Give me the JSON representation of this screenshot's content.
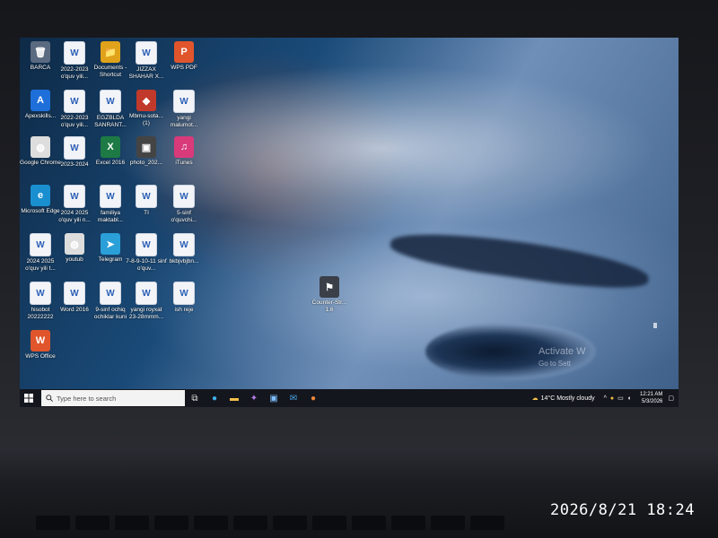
{
  "desktop": {
    "icons": [
      {
        "label": "BARCA",
        "glyph": "🗑",
        "color": "#5a6a80"
      },
      {
        "label": "2022-2023 o'quv yili...",
        "glyph": "W",
        "color": "#2b5fb7"
      },
      {
        "label": "Documents - Shortcut",
        "glyph": "📁",
        "color": "#e0a21a"
      },
      {
        "label": "JIZZAX SHAHAR X...",
        "glyph": "W",
        "color": "#2b5fb7"
      },
      {
        "label": "WPS PDF",
        "glyph": "P",
        "color": "#e0552b"
      },
      {
        "label": "Apexskills...",
        "glyph": "A",
        "color": "#1e6fd9"
      },
      {
        "label": "2022-2023 o'quv yili...",
        "glyph": "W",
        "color": "#2b5fb7"
      },
      {
        "label": "EGZBLDA SANRANT...",
        "glyph": "W",
        "color": "#2b5fb7"
      },
      {
        "label": "Mbmu-sota... (1)",
        "glyph": "◆",
        "color": "#c0392b"
      },
      {
        "label": "yangi malumot...",
        "glyph": "W",
        "color": "#2b5fb7"
      },
      {
        "label": "Google Chrome",
        "glyph": "◍",
        "color": "#dddddd"
      },
      {
        "label": "2023-2024",
        "glyph": "W",
        "color": "#2b5fb7"
      },
      {
        "label": "Excel 2016",
        "glyph": "X",
        "color": "#1d7a44"
      },
      {
        "label": "photo_202...",
        "glyph": "▣",
        "color": "#444444"
      },
      {
        "label": "iTunes",
        "glyph": "♫",
        "color": "#d83a7a"
      },
      {
        "label": "Microsoft Edge",
        "glyph": "e",
        "color": "#1a8fd0"
      },
      {
        "label": "2024 2025 o'quv yili n...",
        "glyph": "W",
        "color": "#2b5fb7"
      },
      {
        "label": "familiya maktabl...",
        "glyph": "W",
        "color": "#2b5fb7"
      },
      {
        "label": "TI",
        "glyph": "W",
        "color": "#2b5fb7"
      },
      {
        "label": "5-sinf o'quvchi...",
        "glyph": "W",
        "color": "#2b5fb7"
      },
      {
        "label": "2024 2025 o'quv yili t...",
        "glyph": "W",
        "color": "#2b5fb7"
      },
      {
        "label": "youtub",
        "glyph": "◍",
        "color": "#dddddd"
      },
      {
        "label": "Telegram",
        "glyph": "➤",
        "color": "#2a9fd8"
      },
      {
        "label": "7-8-9-10-11 sinf o'quv...",
        "glyph": "W",
        "color": "#2b5fb7"
      },
      {
        "label": "bkbjvbjbn...",
        "glyph": "W",
        "color": "#2b5fb7"
      },
      {
        "label": "hisobot 20222222",
        "glyph": "W",
        "color": "#2b5fb7"
      },
      {
        "label": "Word 2016",
        "glyph": "W",
        "color": "#2b5fb7"
      },
      {
        "label": "9-sinf ochiq ochiklar kuni",
        "glyph": "W",
        "color": "#2b5fb7"
      },
      {
        "label": "yangi royxat 23-28mmm...",
        "glyph": "W",
        "color": "#2b5fb7"
      },
      {
        "label": "ish reje",
        "glyph": "W",
        "color": "#2b5fb7"
      },
      {
        "label": "WPS Office",
        "glyph": "W",
        "color": "#e0552b"
      },
      {
        "label": "Counter-Str... 1.6",
        "glyph": "⚑",
        "color": "#3a3f48"
      }
    ],
    "watermark_line1": "Activate W",
    "watermark_line2": "Go to Sett"
  },
  "taskbar": {
    "search_placeholder": "Type here to search",
    "weather": "14°C  Mostly cloudy",
    "time": "12:21 AM",
    "date": "5/3/2026",
    "lang": "ENG"
  },
  "photo": {
    "timestamp": "2026/8/21 18:24"
  },
  "colors": {
    "taskbar_bg": "#14161d",
    "accent": "#1e6fd9"
  }
}
